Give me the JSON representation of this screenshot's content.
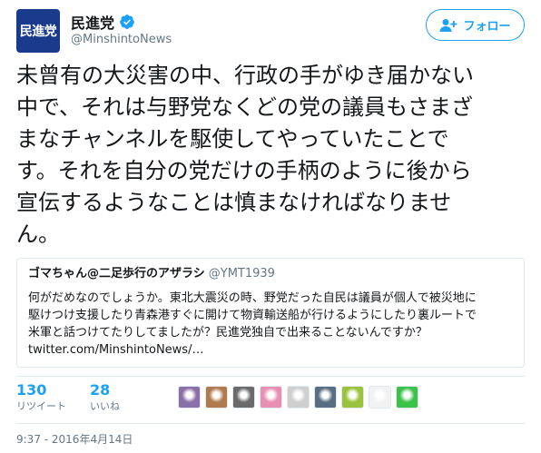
{
  "account": {
    "avatar_text": "民進党",
    "display_name": "民進党",
    "handle": "@MinshintoNews",
    "verified": true
  },
  "follow_button": {
    "label": "フォロー",
    "icon": "add-user-icon"
  },
  "tweet": {
    "text": "未曾有の大災害の中、行政の手がゆき届かない\n中で、それは与野党なくどの党の議員もさまざ\nまなチャンネルを駆使してやっていたことで\nす。それを自分の党だけの手柄のように後から\n宣伝するようなことは慎まなければなりませ\nん。"
  },
  "quoted_tweet": {
    "name": "ゴマちゃん@二足歩行のアザラシ",
    "handle": "@YMT1939",
    "text": "何がだめなのでしょうか。東北大震災の時、野党だった自民は議員が個人で被災地に\n駆けつけ支援したり青森港すぐに開けて物資輸送船が行けるようにしたり裏ルートで\n米軍と話つけてたりしてましたが？民進党独自で出来ることないんですか？\ntwitter.com/MinshintoNews/…"
  },
  "stats": {
    "retweets_count": "130",
    "retweets_label": "リツイート",
    "likes_count": "28",
    "likes_label": "いいね"
  },
  "liker_avatars": [
    {
      "color": "#8a6fa8"
    },
    {
      "color": "#b07a4f"
    },
    {
      "color": "#6a6a6a"
    },
    {
      "color": "#e88fb4"
    },
    {
      "color": "#cfcfcf"
    },
    {
      "color": "#5a6e82"
    },
    {
      "color": "#9ac23c"
    },
    {
      "color": "#f2f2f2"
    },
    {
      "color": "#3cc24a"
    }
  ],
  "timestamp": "9:37 - 2016年4月14日",
  "colors": {
    "accent": "#1da1f2",
    "brand_avatar": "#1a3a8c",
    "secondary_text": "#657786",
    "border": "#e1e8ed"
  }
}
